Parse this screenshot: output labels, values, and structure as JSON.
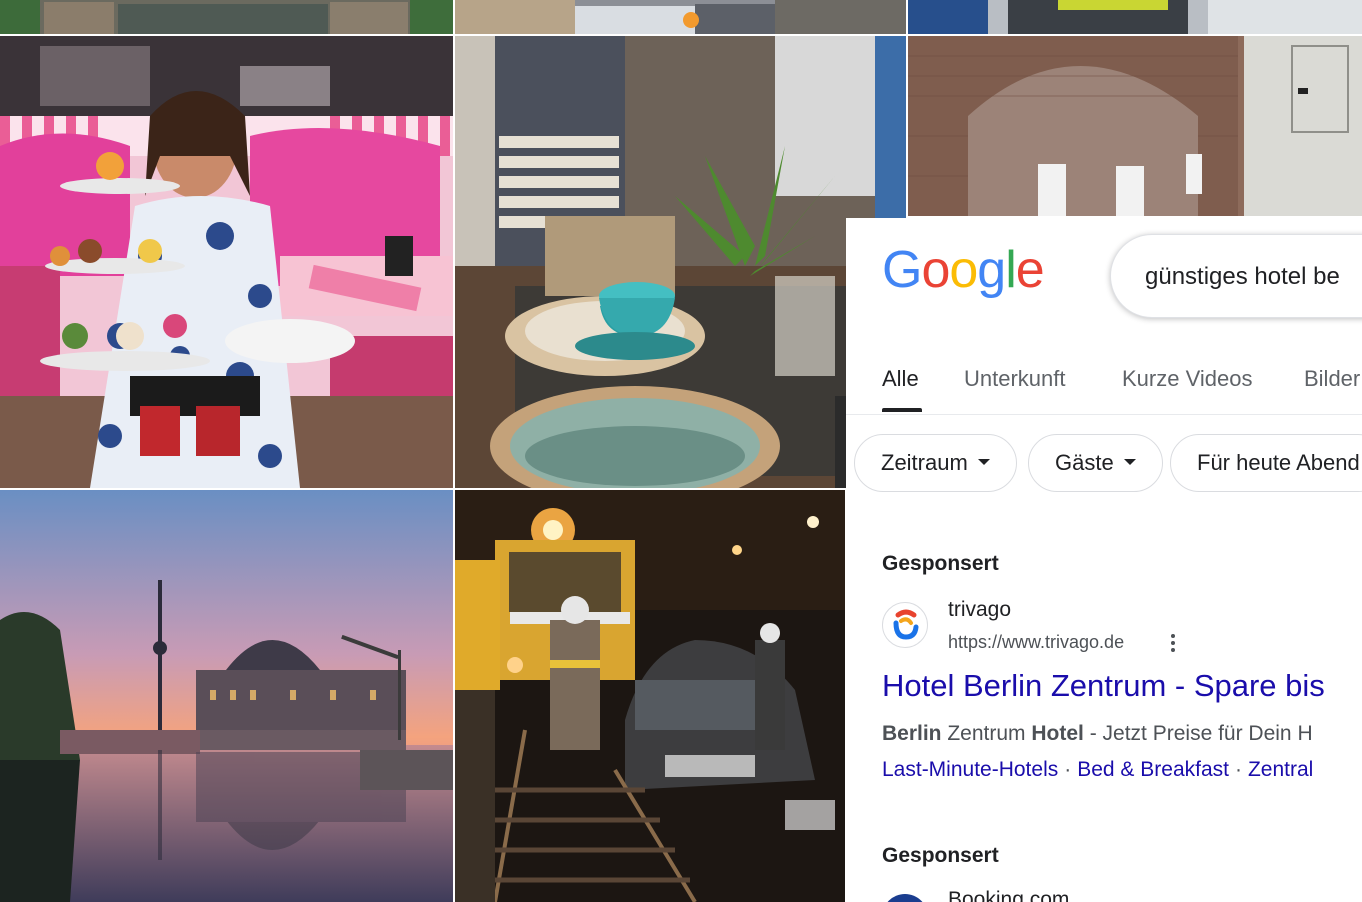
{
  "images": [
    {
      "name": "statue-base"
    },
    {
      "name": "street-cars"
    },
    {
      "name": "worker-vest"
    },
    {
      "name": "cafe-waitress"
    },
    {
      "name": "decor-shop"
    },
    {
      "name": "brick-ruin"
    },
    {
      "name": "berlin-tv-tower-sunset"
    },
    {
      "name": "tram-accident-night"
    }
  ],
  "google": {
    "logo": [
      "G",
      "o",
      "o",
      "g",
      "l",
      "e"
    ],
    "logo_colors": [
      "#4285F4",
      "#EA4335",
      "#FBBC05",
      "#4285F4",
      "#34A853",
      "#EA4335"
    ],
    "search_query": "günstiges hotel be",
    "tabs": [
      {
        "label": "Alle",
        "active": true
      },
      {
        "label": "Unterkunft"
      },
      {
        "label": "Kurze Videos"
      },
      {
        "label": "Bilder"
      }
    ],
    "chips": [
      {
        "label": "Zeitraum",
        "dropdown": true
      },
      {
        "label": "Gäste",
        "dropdown": true
      },
      {
        "label": "Für heute Abend"
      }
    ],
    "results": [
      {
        "sponsored_label": "Gesponsert",
        "site_name": "trivago",
        "url": "https://www.trivago.de",
        "title": "Hotel Berlin Zentrum - Spare bis",
        "desc_bold_1": "Berlin",
        "desc_text_1": " Zentrum ",
        "desc_bold_2": "Hotel",
        "desc_text_2": " - Jetzt Preise für Dein H",
        "sitelinks": [
          "Last-Minute-Hotels",
          "Bed & Breakfast",
          "Zentral"
        ]
      },
      {
        "sponsored_label": "Gesponsert",
        "site_name": "Booking.com"
      }
    ]
  },
  "colors": {
    "link": "#1a0dab",
    "text": "#202124",
    "muted": "#4d5156",
    "pink": "#e83e8c"
  }
}
